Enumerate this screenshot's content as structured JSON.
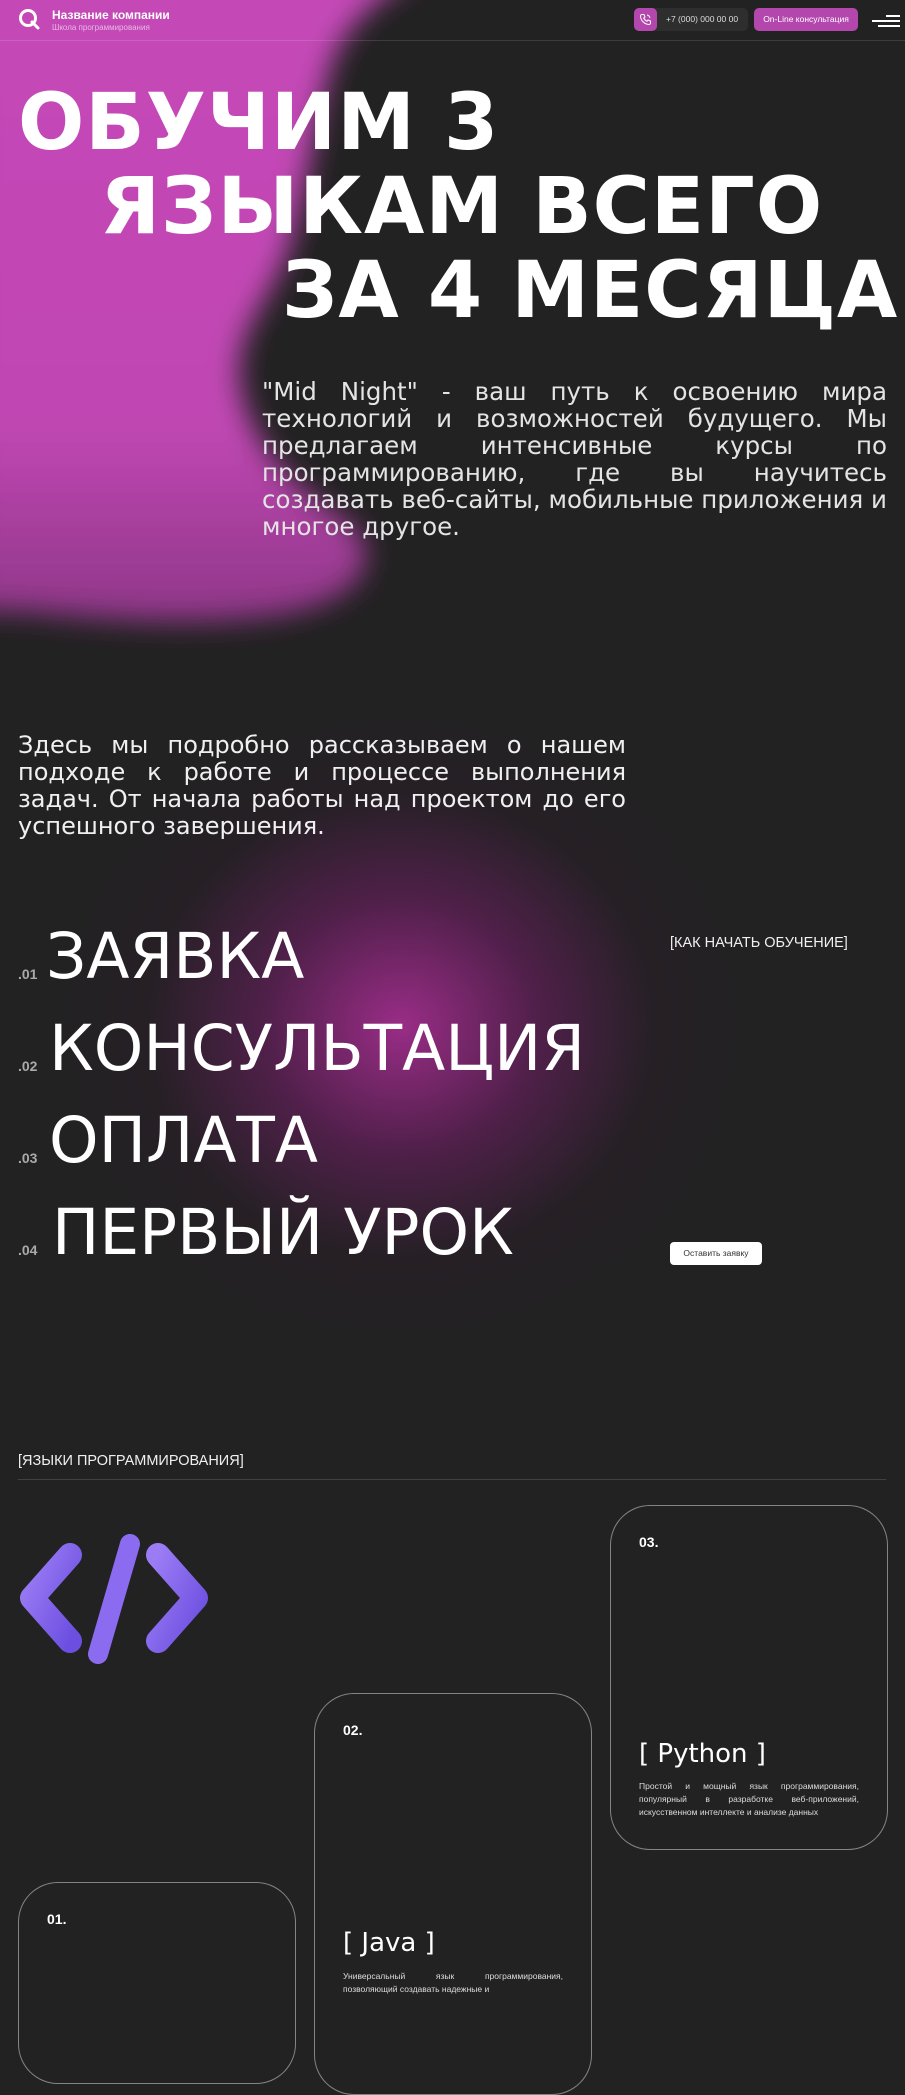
{
  "header": {
    "company_name": "Название компании",
    "company_subtitle": "Школа программирования",
    "phone": "+7 (000) 000 00 00",
    "consult_label": "On-Line консультация",
    "icons": [
      "logo-icon",
      "phone-icon",
      "menu-icon"
    ]
  },
  "hero": {
    "title_line_1": "ОБУЧИМ 3",
    "title_line_2": "ЯЗЫКАМ ВСЕГО",
    "title_line_3": "ЗА 4 МЕСЯЦА",
    "description": "\"Mid Night\" - ваш путь к освоению мира технологий и возможностей будущего. Мы предлагаем интенсивные курсы по программированию, где вы научитесь создавать веб-сайты, мобильные приложения и многое другое."
  },
  "process": {
    "intro": "Здесь мы подробно рассказываем о нашем подходе к работе и процессе выполнения задач.  От начала работы над проектом до его успешного завершения.",
    "tag": "[КАК НАЧАТЬ ОБУЧЕНИЕ]",
    "steps": [
      {
        "num": ".01",
        "label": "ЗАЯВКА"
      },
      {
        "num": ".02",
        "label": "КОНСУЛЬТАЦИЯ"
      },
      {
        "num": ".03",
        "label": "ОПЛАТА"
      },
      {
        "num": ".04",
        "label": "ПЕРВЫЙ УРОК"
      }
    ],
    "cta_label": "Оставить заявку"
  },
  "languages": {
    "tag": "[ЯЗЫКИ ПРОГРАММИРОВАНИЯ]",
    "icon": "code-icon",
    "cards": [
      {
        "num": "01.",
        "name": "",
        "description": ""
      },
      {
        "num": "02.",
        "name": "[ Java ]",
        "description": "Универсальный язык программирования, позволяющий создавать надежные и"
      },
      {
        "num": "03.",
        "name": "[ Python ]",
        "description": "Простой и мощный язык программирования, популярный в разработке веб-приложений, искусственном интеллекте и анализе данных"
      }
    ]
  },
  "colors": {
    "background": "#222222",
    "accent": "#b347ad",
    "hero_magenta": "#c548b8"
  }
}
